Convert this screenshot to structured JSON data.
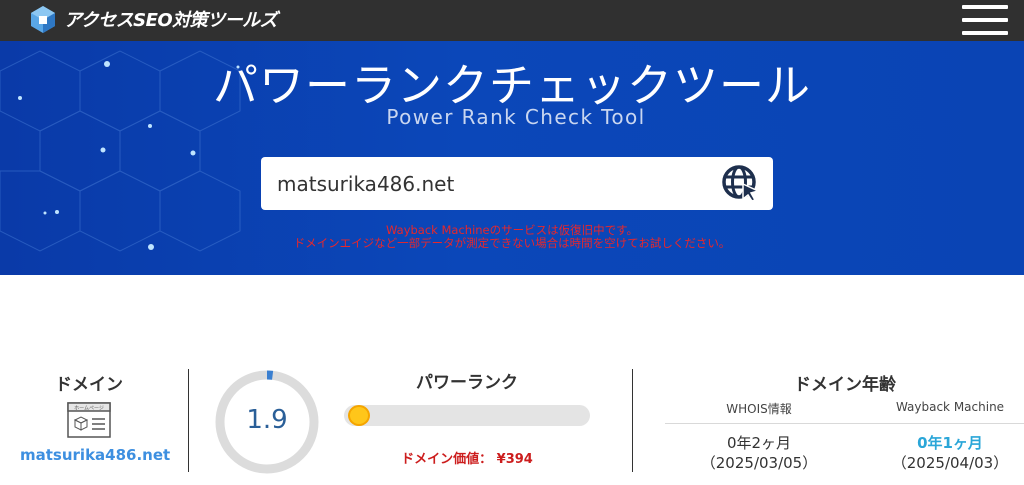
{
  "header": {
    "logo_text": "アクセスSEO対策ツールズ",
    "menu_icon": "hamburger-menu-icon"
  },
  "hero": {
    "title": "パワーランクチェックツール",
    "subtitle": "Power Rank Check Tool",
    "search": {
      "value": "matsurika486.net",
      "button_icon": "globe-cursor-icon"
    },
    "notice_line1": "Wayback Machineのサービスは仮復旧中です。",
    "notice_line2": "ドメインエイジなど一部データが測定できない場合は時間を空けてお試しください。"
  },
  "results": {
    "domain": {
      "title": "ドメイン",
      "icon": "homepage-icon",
      "icon_label": "ホームページ",
      "value": "matsurika486.net"
    },
    "power_rank": {
      "title": "パワーランク",
      "score": "1.9",
      "score_fraction": 0.019,
      "bar_fraction": 0.02,
      "value_text": "ドメイン価値： ¥394"
    },
    "domain_age": {
      "title": "ドメイン年齢",
      "whois_label": "WHOIS情報",
      "wayback_label": "Wayback Machine",
      "whois_age": "0年2ヶ月",
      "whois_date": "（2025/03/05）",
      "wayback_age": "0年1ヶ月",
      "wayback_date": "（2025/04/03）"
    }
  },
  "colors": {
    "header_bg": "#303030",
    "hero_bg": "#0b47b9",
    "notice": "#e8272b",
    "link": "#3d8fe0",
    "price": "#cc1d1d",
    "wayback_value": "#2aa6d8",
    "gauge_value": "#2a5f98"
  }
}
